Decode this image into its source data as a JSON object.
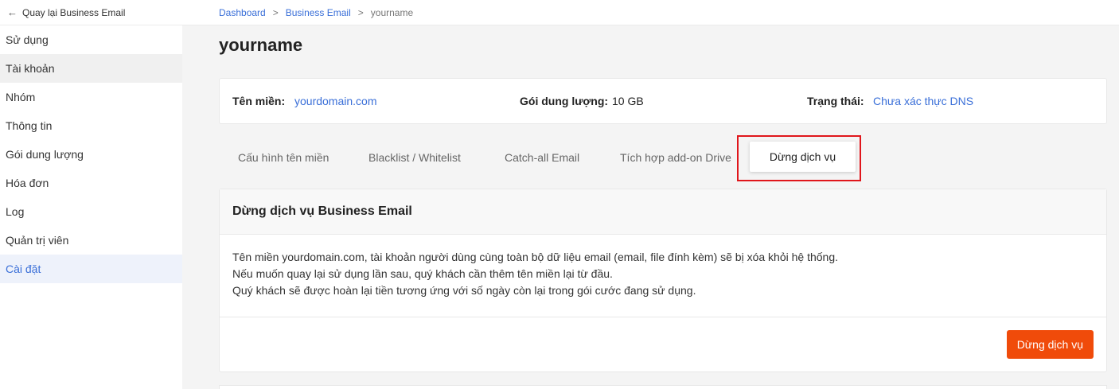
{
  "sidebar": {
    "back_label": "Quay lại Business Email",
    "items": [
      {
        "label": "Sử dụng"
      },
      {
        "label": "Tài khoản"
      },
      {
        "label": "Nhóm"
      },
      {
        "label": "Thông tin"
      },
      {
        "label": "Gói dung lượng"
      },
      {
        "label": "Hóa đơn"
      },
      {
        "label": "Log"
      },
      {
        "label": "Quản trị viên"
      },
      {
        "label": "Cài đặt"
      }
    ]
  },
  "breadcrumb": {
    "items": [
      "Dashboard",
      "Business Email",
      "yourname"
    ],
    "separator": ">"
  },
  "page": {
    "title": "yourname"
  },
  "info": {
    "domain_label": "Tên miền:",
    "domain_value": "yourdomain.com",
    "plan_label": "Gói dung lượng:",
    "plan_value": "10 GB",
    "status_label": "Trạng thái:",
    "status_value": "Chưa xác thực DNS"
  },
  "tabs": [
    {
      "label": "Cấu hình tên miền"
    },
    {
      "label": "Blacklist / Whitelist"
    },
    {
      "label": "Catch-all Email"
    },
    {
      "label": "Tích hợp add-on Drive"
    },
    {
      "label": "Dừng dịch vụ"
    }
  ],
  "panel": {
    "title": "Dừng dịch vụ Business Email",
    "lines": [
      "Tên miền yourdomain.com, tài khoản người dùng cùng toàn bộ dữ liệu email (email, file đính kèm) sẽ bị xóa khỏi hệ thống.",
      "Nếu muốn quay lại sử dụng lần sau, quý khách cần thêm tên miền lại từ đầu.",
      "Quý khách sẽ được hoàn lại tiền tương ứng với số ngày còn lại trong gói cước đang sử dụng."
    ],
    "button_label": "Dừng dịch vụ"
  },
  "colors": {
    "accent": "#3a6fd8",
    "danger_button": "#f04b0a",
    "highlight_box": "#e0161b"
  }
}
